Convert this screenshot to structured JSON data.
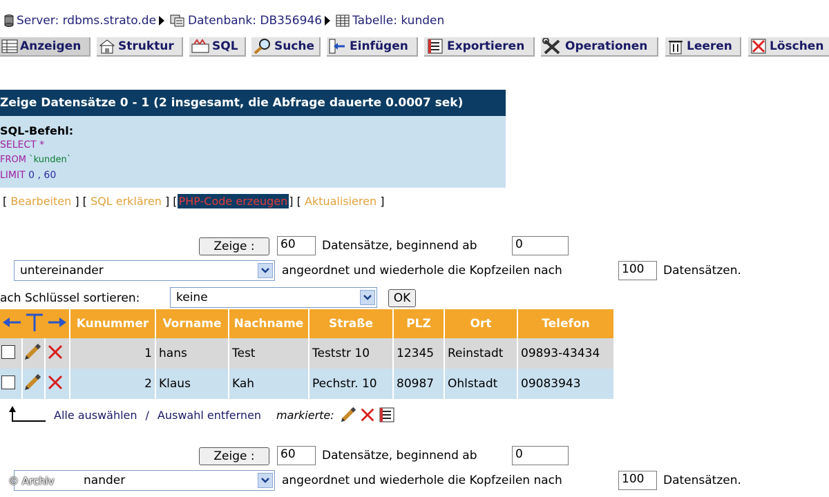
{
  "breadcrumb": {
    "server_label": "Server:",
    "server": "rdbms.strato.de",
    "db_label": "Datenbank:",
    "db": "DB356946",
    "table_label": "Tabelle:",
    "table": "kunden"
  },
  "tabs": [
    {
      "label": "Anzeigen",
      "icon": "browse-icon"
    },
    {
      "label": "Struktur",
      "icon": "structure-icon"
    },
    {
      "label": "SQL",
      "icon": "sql-icon"
    },
    {
      "label": "Suche",
      "icon": "search-icon"
    },
    {
      "label": "Einfügen",
      "icon": "insert-icon"
    },
    {
      "label": "Exportieren",
      "icon": "export-icon"
    },
    {
      "label": "Operationen",
      "icon": "operations-icon"
    },
    {
      "label": "Leeren",
      "icon": "empty-icon"
    },
    {
      "label": "Löschen",
      "icon": "drop-icon"
    }
  ],
  "query": {
    "header": "Zeige Datensätze 0 - 1 (2 insgesamt, die Abfrage dauerte 0.0007 sek)",
    "sql_label": "SQL-Befehl:",
    "line1": "SELECT *",
    "line2_kw": "FROM",
    "line2_tbl": "`kunden`",
    "line3_kw": "LIMIT",
    "line3_val": "0 , 60"
  },
  "links": {
    "edit": "Bearbeiten",
    "explain": "SQL erklären",
    "php": "PHP-Code erzeugen",
    "refresh": "Aktualisieren"
  },
  "nav_top": {
    "show_button": "Zeige :",
    "rows": "60",
    "rows_text": "Datensätze, beginnend ab",
    "start": "0",
    "mode": "untereinander",
    "repeat_text": "angeordnet und wiederhole die Kopfzeilen nach",
    "repeat": "100",
    "repeat_suffix": "Datensätzen."
  },
  "sort": {
    "label": "ach Schlüssel sortieren:",
    "value": "keine",
    "ok": "OK"
  },
  "table": {
    "columns": [
      "Kunummer",
      "Vorname",
      "Nachname",
      "Straße",
      "PLZ",
      "Ort",
      "Telefon"
    ],
    "rows": [
      [
        "1",
        "hans",
        "Test",
        "Teststr 10",
        "12345",
        "Reinstadt",
        "09893-43434"
      ],
      [
        "2",
        "Klaus",
        "Kah",
        "Pechstr. 10",
        "80987",
        "Ohlstadt",
        "09083943"
      ]
    ]
  },
  "selection": {
    "select_all": "Alle auswählen",
    "sep": "/",
    "deselect": "Auswahl entfernen",
    "marked": "markierte:"
  },
  "nav_bottom": {
    "show_button": "Zeige :",
    "rows": "60",
    "rows_text": "Datensätze, beginnend ab",
    "start": "0",
    "mode": "nander",
    "repeat_text": "angeordnet und wiederhole die Kopfzeilen nach",
    "repeat": "100",
    "repeat_suffix": "Datensätzen."
  },
  "copyright": "© Archiv",
  "colors": {
    "header_bg": "#0c3c63",
    "query_bg": "#c9e0ef",
    "table_head": "#f3a62a",
    "link": "#e0a23b"
  }
}
